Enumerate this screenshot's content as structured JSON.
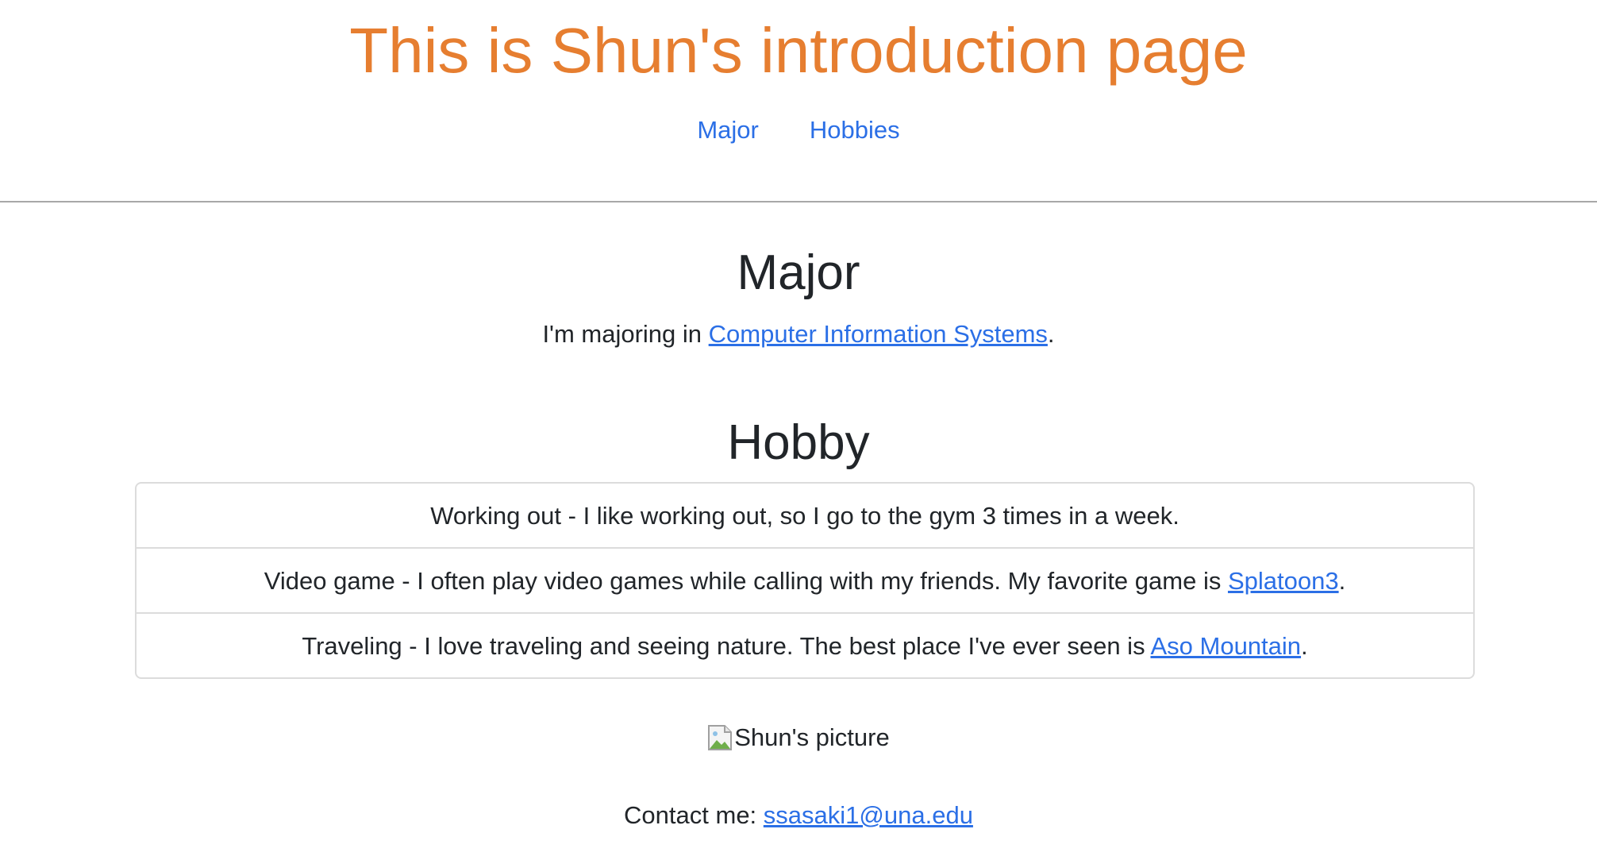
{
  "header": {
    "title": "This is Shun's introduction page",
    "nav": [
      {
        "label": "Major"
      },
      {
        "label": "Hobbies"
      }
    ]
  },
  "major": {
    "heading": "Major",
    "text_before": "I'm majoring in ",
    "link_text": "Computer Information Systems",
    "text_after": "."
  },
  "hobby": {
    "heading": "Hobby",
    "items": [
      {
        "text_before": "Working out - I like working out, so I go to the gym 3 times in a week.",
        "link_text": "",
        "text_after": ""
      },
      {
        "text_before": "Video game - I often play video games while calling with my friends. My favorite game is ",
        "link_text": "Splatoon3",
        "text_after": "."
      },
      {
        "text_before": "Traveling - I love traveling and seeing nature. The best place I've ever seen is ",
        "link_text": "Aso Mountain",
        "text_after": "."
      }
    ]
  },
  "picture": {
    "alt": "Shun's picture",
    "icon": "broken-image-icon"
  },
  "contact": {
    "label": "Contact me: ",
    "email": "ssasaki1@una.edu"
  },
  "colors": {
    "title": "#e67e30",
    "link": "#2b6fe6",
    "text": "#212529",
    "divider": "#a8a8a8"
  }
}
